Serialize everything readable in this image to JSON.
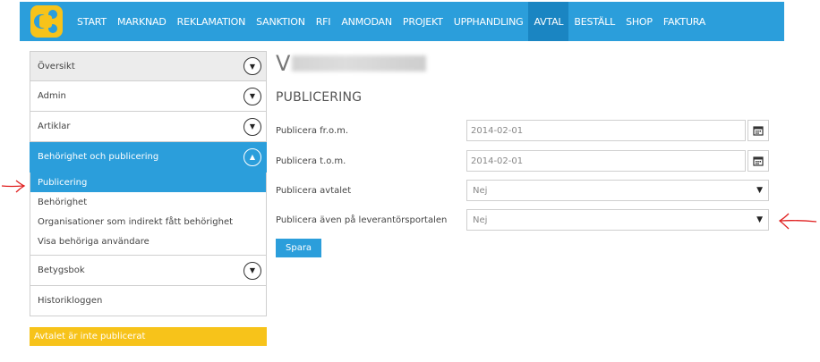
{
  "nav": {
    "items": [
      {
        "label": "START"
      },
      {
        "label": "MARKNAD"
      },
      {
        "label": "REKLAMATION"
      },
      {
        "label": "SANKTION"
      },
      {
        "label": "RFI"
      },
      {
        "label": "ANMODAN"
      },
      {
        "label": "PROJEKT"
      },
      {
        "label": "UPPHANDLING"
      },
      {
        "label": "AVTAL",
        "active": true
      },
      {
        "label": "BESTÄLL"
      },
      {
        "label": "SHOP"
      },
      {
        "label": "FAKTURA"
      }
    ]
  },
  "sidebar": {
    "overview": "Översikt",
    "admin": "Admin",
    "articles": "Artiklar",
    "auth_section": "Behörighet och publicering",
    "sub_items": [
      {
        "label": "Publicering",
        "selected": true
      },
      {
        "label": "Behörighet"
      },
      {
        "label": "Organisationer som indirekt fått behörighet"
      },
      {
        "label": "Visa behöriga användare"
      }
    ],
    "gradebook": "Betygsbok",
    "history": "Historikloggen",
    "notice": "Avtalet är inte publicerat"
  },
  "main": {
    "title_visible": "V",
    "section_heading": "PUBLICERING",
    "publish_from_label": "Publicera fr.o.m.",
    "publish_from_value": "2014-02-01",
    "publish_to_label": "Publicera t.o.m.",
    "publish_to_value": "2014-02-01",
    "publish_contract_label": "Publicera avtalet",
    "publish_contract_value": "Nej",
    "publish_supplier_label": "Publicera även på leverantörsportalen",
    "publish_supplier_value": "Nej",
    "save_label": "Spara"
  },
  "colors": {
    "brand_blue": "#2b9edb",
    "notice_yellow": "#f7c31a",
    "annotation_red": "#e02020"
  }
}
